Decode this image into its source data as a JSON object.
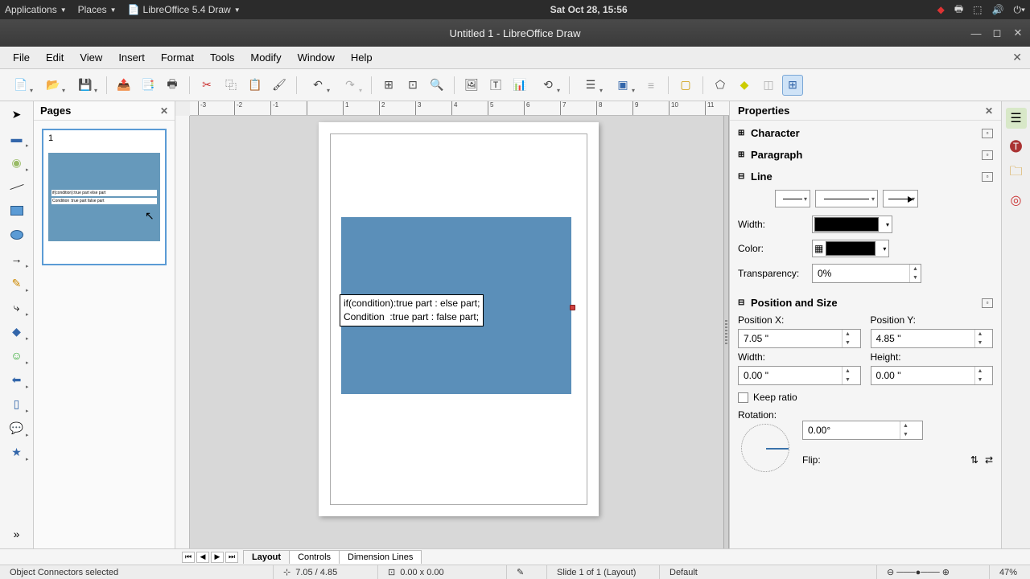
{
  "sysbar": {
    "apps": "Applications",
    "places": "Places",
    "app": "LibreOffice 5.4 Draw",
    "clock": "Sat Oct 28, 15:56"
  },
  "titlebar": {
    "title": "Untitled 1 - LibreOffice Draw"
  },
  "menus": [
    "File",
    "Edit",
    "View",
    "Insert",
    "Format",
    "Tools",
    "Modify",
    "Window",
    "Help"
  ],
  "pages": {
    "title": "Pages",
    "num": "1"
  },
  "canvas": {
    "text1": "if(condition):true part : else part;",
    "text2": "Condition  :true part : false part;"
  },
  "properties": {
    "title": "Properties",
    "sections": {
      "character": "Character",
      "paragraph": "Paragraph",
      "line": "Line",
      "possize": "Position and Size"
    },
    "width_lbl": "Width:",
    "color_lbl": "Color:",
    "transp_lbl": "Transparency:",
    "transp_val": "0%",
    "posx_lbl": "Position X:",
    "posy_lbl": "Position Y:",
    "posx_val": "7.05 \"",
    "posy_val": "4.85 \"",
    "w_lbl": "Width:",
    "h_lbl": "Height:",
    "w_val": "0.00 \"",
    "h_val": "0.00 \"",
    "keep": "Keep ratio",
    "rot_lbl": "Rotation:",
    "rot_val": "0.00°",
    "flip_lbl": "Flip:"
  },
  "tabs": {
    "layout": "Layout",
    "controls": "Controls",
    "dim": "Dimension Lines"
  },
  "status": {
    "sel": "Object Connectors selected",
    "pos": "7.05 / 4.85",
    "size": "0.00 x 0.00",
    "slide": "Slide 1 of 1 (Layout)",
    "style": "Default",
    "zoom": "47%"
  },
  "ruler_ticks": [
    "-3",
    "-2",
    "-1",
    "",
    "1",
    "2",
    "3",
    "4",
    "5",
    "6",
    "7",
    "8",
    "9",
    "10",
    "11"
  ]
}
